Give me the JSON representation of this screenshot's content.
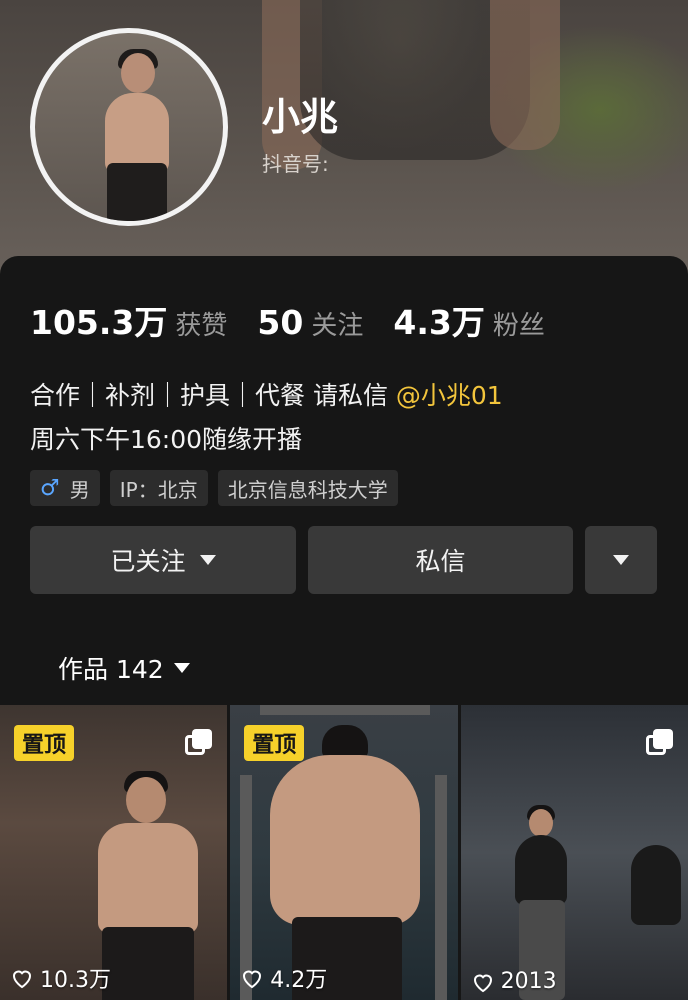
{
  "profile": {
    "name": "小兆",
    "douyin_id_label": "抖音号:"
  },
  "stats": [
    {
      "value": "105.3万",
      "label": "获赞"
    },
    {
      "value": "50",
      "label": "关注"
    },
    {
      "value": "4.3万",
      "label": "粉丝"
    }
  ],
  "bio": {
    "line1": "合作｜补剂｜护具｜代餐 请私信 ",
    "mention": "@小兆01",
    "line2": "周六下午16:00随缘开播"
  },
  "tags": {
    "gender_icon": "male-icon",
    "gender": "男",
    "ip": "IP：北京",
    "school": "北京信息科技大学"
  },
  "actions": {
    "follow_label": "已关注",
    "message_label": "私信"
  },
  "works_tab": {
    "label": "作品 142"
  },
  "grid": [
    {
      "pinned_label": "置顶",
      "likes": "10.3万",
      "multi": true
    },
    {
      "pinned_label": "置顶",
      "likes": "4.2万",
      "multi": false
    },
    {
      "pinned_label": "",
      "likes": "2013",
      "multi": true
    }
  ],
  "colors": {
    "background": "#161616",
    "mention": "#f3c53c",
    "pin_badge": "#f6d12a",
    "button": "#393939"
  }
}
